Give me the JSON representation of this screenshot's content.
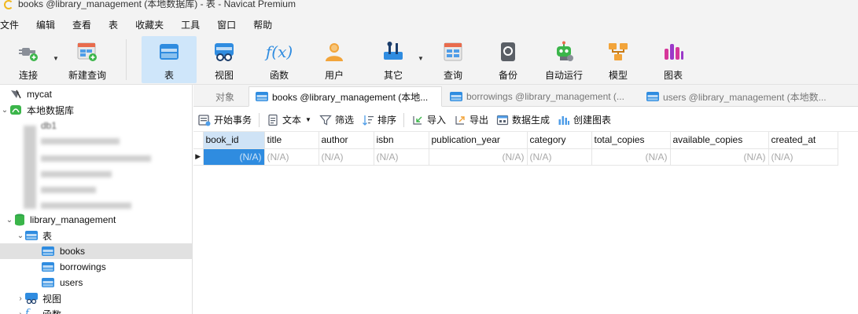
{
  "window": {
    "title": "books @library_management (本地数据库) - 表 - Navicat Premium"
  },
  "menu": [
    "文件",
    "编辑",
    "查看",
    "表",
    "收藏夹",
    "工具",
    "窗口",
    "帮助"
  ],
  "toolbar": {
    "connect": "连接",
    "new_query": "新建查询",
    "table": "表",
    "view": "视图",
    "function": "函数",
    "user": "用户",
    "other": "其它",
    "query": "查询",
    "backup": "备份",
    "automation": "自动运行",
    "model": "模型",
    "chart": "图表",
    "function_glyph": "f(x)"
  },
  "nav": {
    "mycat": "mycat",
    "local_db": "本地数据库",
    "first_partial": "db1",
    "library_db": "library_management",
    "tables_group": "表",
    "tables": [
      "books",
      "borrowings",
      "users"
    ],
    "views_group": "视图",
    "functions_group": "函数"
  },
  "tabs": {
    "objects": "对象",
    "books": "books @library_management (本地...",
    "borrowings": "borrowings @library_management (...",
    "users": "users @library_management (本地数..."
  },
  "subbar": {
    "begin_txn": "开始事务",
    "text": "文本",
    "filter": "筛选",
    "sort": "排序",
    "import": "导入",
    "export": "导出",
    "data_gen": "数据生成",
    "create_chart": "创建图表"
  },
  "grid": {
    "columns": [
      "book_id",
      "title",
      "author",
      "isbn",
      "publication_year",
      "category",
      "total_copies",
      "available_copies",
      "created_at"
    ],
    "row": [
      "(N/A)",
      "(N/A)",
      "(N/A)",
      "(N/A)",
      "(N/A)",
      "(N/A)",
      "(N/A)",
      "(N/A)",
      "(N/A)"
    ]
  },
  "colors": {
    "accent": "#2f8ce0",
    "active_tool": "#cfe6fa",
    "selected_nav": "#e1e1e1"
  }
}
